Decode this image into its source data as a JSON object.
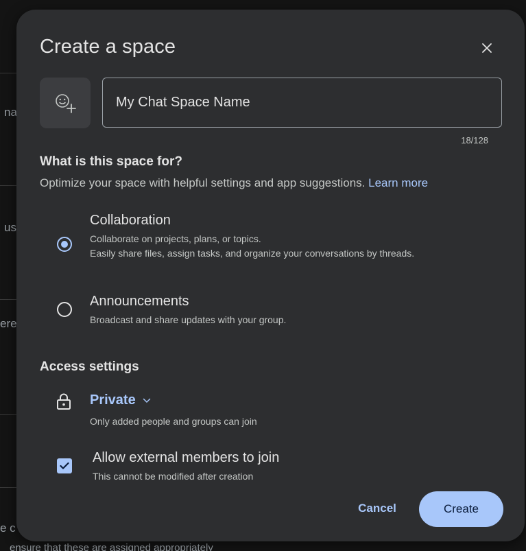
{
  "dialog": {
    "title": "Create a space",
    "close_icon": "close-icon",
    "emoji_icon": "add-emoji-icon"
  },
  "name_input": {
    "value": "My Chat Space Name",
    "char_count": "18/128"
  },
  "purpose": {
    "heading": "What is this space for?",
    "description": "Optimize your space with helpful settings and app suggestions.",
    "learn_more": "Learn more",
    "options": [
      {
        "title": "Collaboration",
        "description_line1": "Collaborate on projects, plans, or topics.",
        "description_line2": "Easily share files, assign tasks, and organize your conversations by threads.",
        "selected": true
      },
      {
        "title": "Announcements",
        "description_line1": "Broadcast and share updates with your group.",
        "selected": false
      }
    ]
  },
  "access": {
    "heading": "Access settings",
    "visibility_label": "Private",
    "visibility_description": "Only added people and groups can join",
    "external_members_label": "Allow external members to join",
    "external_members_note": "This cannot be modified after creation",
    "external_members_checked": true
  },
  "actions": {
    "cancel_label": "Cancel",
    "create_label": "Create"
  },
  "colors": {
    "accent": "#a8c7fa",
    "dialog_bg": "#2d2e30",
    "text_primary": "#e3e3e3",
    "text_secondary": "#c4c7c5"
  },
  "background_fragments": [
    "na",
    "us",
    "ere",
    "e c",
    "ensure that these are assigned appropriately"
  ]
}
